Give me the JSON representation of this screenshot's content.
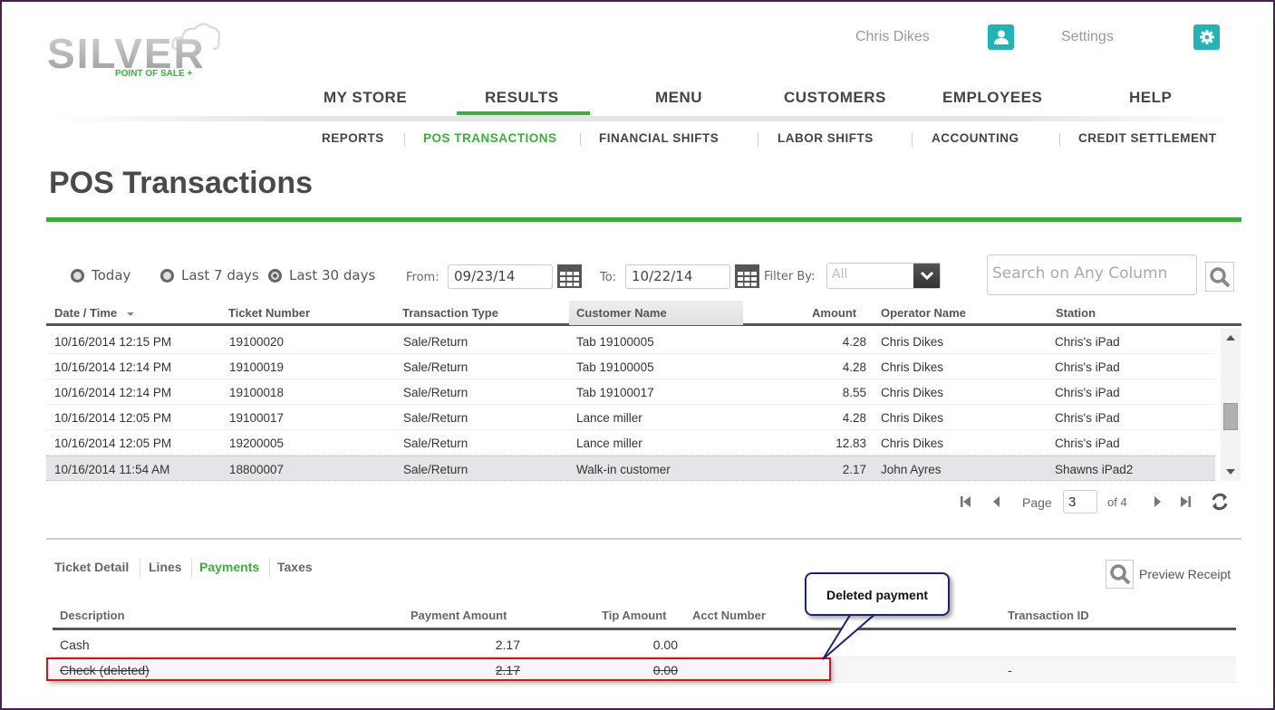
{
  "brand": {
    "name": "SILVER",
    "tagline": "POINT OF SALE +",
    "accent_color": "#3ab03a",
    "icon_color": "#1fb4b7"
  },
  "user_bar": {
    "user_name": "Chris Dikes",
    "user_icon": "user-icon",
    "settings_label": "Settings",
    "settings_icon": "gear-icon"
  },
  "main_nav": {
    "items": [
      {
        "label": "MY STORE",
        "active": false
      },
      {
        "label": "RESULTS",
        "active": true
      },
      {
        "label": "MENU",
        "active": false
      },
      {
        "label": "CUSTOMERS",
        "active": false
      },
      {
        "label": "EMPLOYEES",
        "active": false
      },
      {
        "label": "HELP",
        "active": false
      }
    ]
  },
  "sub_nav": {
    "items": [
      {
        "label": "REPORTS",
        "active": false
      },
      {
        "label": "POS TRANSACTIONS",
        "active": true
      },
      {
        "label": "FINANCIAL SHIFTS",
        "active": false
      },
      {
        "label": "LABOR SHIFTS",
        "active": false
      },
      {
        "label": "ACCOUNTING",
        "active": false
      },
      {
        "label": "CREDIT SETTLEMENT",
        "active": false
      }
    ]
  },
  "page_title": "POS Transactions",
  "filters": {
    "range_options": [
      {
        "label": "Today",
        "checked": false
      },
      {
        "label": "Last 7 days",
        "checked": false
      },
      {
        "label": "Last 30 days",
        "checked": true
      }
    ],
    "from_label": "From:",
    "from_value": "09/23/14",
    "to_label": "To:",
    "to_value": "10/22/14",
    "filter_by_label": "Filter By:",
    "filter_by_value": "All",
    "search_placeholder": "Search on Any Column"
  },
  "transactions": {
    "columns": [
      "Date / Time",
      "Ticket Number",
      "Transaction Type",
      "Customer Name",
      "Amount",
      "Operator Name",
      "Station"
    ],
    "sort_column": "Date / Time",
    "sort_direction": "descending",
    "rows": [
      {
        "datetime": "10/16/2014 12:15 PM",
        "ticket": "19100020",
        "type": "Sale/Return",
        "customer": "Tab 19100005",
        "amount": "4.28",
        "operator": "Chris Dikes",
        "station": "Chris's iPad",
        "selected": false
      },
      {
        "datetime": "10/16/2014 12:14 PM",
        "ticket": "19100019",
        "type": "Sale/Return",
        "customer": "Tab 19100005",
        "amount": "4.28",
        "operator": "Chris Dikes",
        "station": "Chris's iPad",
        "selected": false
      },
      {
        "datetime": "10/16/2014 12:14 PM",
        "ticket": "19100018",
        "type": "Sale/Return",
        "customer": "Tab 19100017",
        "amount": "8.55",
        "operator": "Chris Dikes",
        "station": "Chris's iPad",
        "selected": false
      },
      {
        "datetime": "10/16/2014 12:05 PM",
        "ticket": "19100017",
        "type": "Sale/Return",
        "customer": "Lance miller",
        "amount": "4.28",
        "operator": "Chris Dikes",
        "station": "Chris's iPad",
        "selected": false
      },
      {
        "datetime": "10/16/2014 12:05 PM",
        "ticket": "19200005",
        "type": "Sale/Return",
        "customer": "Lance miller",
        "amount": "12.83",
        "operator": "Chris Dikes",
        "station": "Chris's iPad",
        "selected": false
      },
      {
        "datetime": "10/16/2014 11:54 AM",
        "ticket": "18800007",
        "type": "Sale/Return",
        "customer": "Walk-in customer",
        "amount": "2.17",
        "operator": "John Ayres",
        "station": "Shawns iPad2",
        "selected": true
      }
    ]
  },
  "pager": {
    "page_label": "Page",
    "current_page": "3",
    "of_label": "of 4"
  },
  "detail_tabs": {
    "items": [
      {
        "label": "Ticket Detail",
        "active": false
      },
      {
        "label": "Lines",
        "active": false
      },
      {
        "label": "Payments",
        "active": true
      },
      {
        "label": "Taxes",
        "active": false
      }
    ],
    "preview_receipt_label": "Preview Receipt"
  },
  "payments": {
    "columns": [
      "Description",
      "Payment Amount",
      "Tip Amount",
      "Acct Number",
      "Transaction ID"
    ],
    "rows": [
      {
        "description": "Cash",
        "payment_amount": "2.17",
        "tip_amount": "0.00",
        "acct_number": "",
        "transaction_id": "",
        "deleted": false
      },
      {
        "description": "Check (deleted)",
        "payment_amount": "2.17",
        "tip_amount": "0.00",
        "acct_number": "",
        "transaction_id": "-",
        "deleted": true
      }
    ]
  },
  "annotation": {
    "callout_text": "Deleted payment",
    "highlight_color": "#e01010",
    "callout_border_color": "#1a237e"
  }
}
